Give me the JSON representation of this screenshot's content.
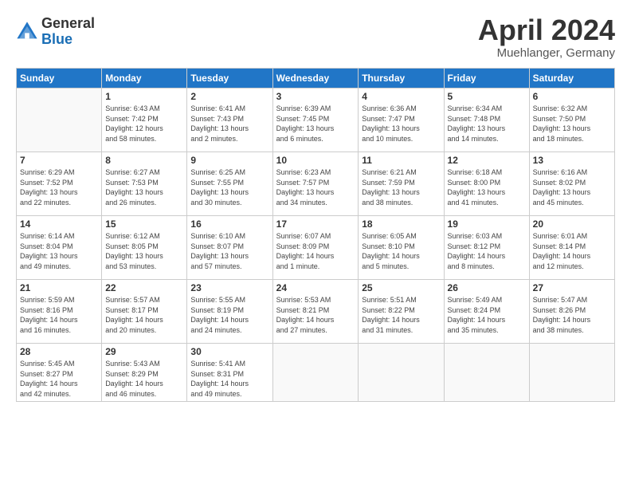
{
  "header": {
    "logo": {
      "general": "General",
      "blue": "Blue"
    },
    "title": "April 2024",
    "location": "Muehlanger, Germany"
  },
  "calendar": {
    "days_of_week": [
      "Sunday",
      "Monday",
      "Tuesday",
      "Wednesday",
      "Thursday",
      "Friday",
      "Saturday"
    ],
    "weeks": [
      [
        {
          "day": "",
          "info": ""
        },
        {
          "day": "1",
          "info": "Sunrise: 6:43 AM\nSunset: 7:42 PM\nDaylight: 12 hours\nand 58 minutes."
        },
        {
          "day": "2",
          "info": "Sunrise: 6:41 AM\nSunset: 7:43 PM\nDaylight: 13 hours\nand 2 minutes."
        },
        {
          "day": "3",
          "info": "Sunrise: 6:39 AM\nSunset: 7:45 PM\nDaylight: 13 hours\nand 6 minutes."
        },
        {
          "day": "4",
          "info": "Sunrise: 6:36 AM\nSunset: 7:47 PM\nDaylight: 13 hours\nand 10 minutes."
        },
        {
          "day": "5",
          "info": "Sunrise: 6:34 AM\nSunset: 7:48 PM\nDaylight: 13 hours\nand 14 minutes."
        },
        {
          "day": "6",
          "info": "Sunrise: 6:32 AM\nSunset: 7:50 PM\nDaylight: 13 hours\nand 18 minutes."
        }
      ],
      [
        {
          "day": "7",
          "info": "Sunrise: 6:29 AM\nSunset: 7:52 PM\nDaylight: 13 hours\nand 22 minutes."
        },
        {
          "day": "8",
          "info": "Sunrise: 6:27 AM\nSunset: 7:53 PM\nDaylight: 13 hours\nand 26 minutes."
        },
        {
          "day": "9",
          "info": "Sunrise: 6:25 AM\nSunset: 7:55 PM\nDaylight: 13 hours\nand 30 minutes."
        },
        {
          "day": "10",
          "info": "Sunrise: 6:23 AM\nSunset: 7:57 PM\nDaylight: 13 hours\nand 34 minutes."
        },
        {
          "day": "11",
          "info": "Sunrise: 6:21 AM\nSunset: 7:59 PM\nDaylight: 13 hours\nand 38 minutes."
        },
        {
          "day": "12",
          "info": "Sunrise: 6:18 AM\nSunset: 8:00 PM\nDaylight: 13 hours\nand 41 minutes."
        },
        {
          "day": "13",
          "info": "Sunrise: 6:16 AM\nSunset: 8:02 PM\nDaylight: 13 hours\nand 45 minutes."
        }
      ],
      [
        {
          "day": "14",
          "info": "Sunrise: 6:14 AM\nSunset: 8:04 PM\nDaylight: 13 hours\nand 49 minutes."
        },
        {
          "day": "15",
          "info": "Sunrise: 6:12 AM\nSunset: 8:05 PM\nDaylight: 13 hours\nand 53 minutes."
        },
        {
          "day": "16",
          "info": "Sunrise: 6:10 AM\nSunset: 8:07 PM\nDaylight: 13 hours\nand 57 minutes."
        },
        {
          "day": "17",
          "info": "Sunrise: 6:07 AM\nSunset: 8:09 PM\nDaylight: 14 hours\nand 1 minute."
        },
        {
          "day": "18",
          "info": "Sunrise: 6:05 AM\nSunset: 8:10 PM\nDaylight: 14 hours\nand 5 minutes."
        },
        {
          "day": "19",
          "info": "Sunrise: 6:03 AM\nSunset: 8:12 PM\nDaylight: 14 hours\nand 8 minutes."
        },
        {
          "day": "20",
          "info": "Sunrise: 6:01 AM\nSunset: 8:14 PM\nDaylight: 14 hours\nand 12 minutes."
        }
      ],
      [
        {
          "day": "21",
          "info": "Sunrise: 5:59 AM\nSunset: 8:16 PM\nDaylight: 14 hours\nand 16 minutes."
        },
        {
          "day": "22",
          "info": "Sunrise: 5:57 AM\nSunset: 8:17 PM\nDaylight: 14 hours\nand 20 minutes."
        },
        {
          "day": "23",
          "info": "Sunrise: 5:55 AM\nSunset: 8:19 PM\nDaylight: 14 hours\nand 24 minutes."
        },
        {
          "day": "24",
          "info": "Sunrise: 5:53 AM\nSunset: 8:21 PM\nDaylight: 14 hours\nand 27 minutes."
        },
        {
          "day": "25",
          "info": "Sunrise: 5:51 AM\nSunset: 8:22 PM\nDaylight: 14 hours\nand 31 minutes."
        },
        {
          "day": "26",
          "info": "Sunrise: 5:49 AM\nSunset: 8:24 PM\nDaylight: 14 hours\nand 35 minutes."
        },
        {
          "day": "27",
          "info": "Sunrise: 5:47 AM\nSunset: 8:26 PM\nDaylight: 14 hours\nand 38 minutes."
        }
      ],
      [
        {
          "day": "28",
          "info": "Sunrise: 5:45 AM\nSunset: 8:27 PM\nDaylight: 14 hours\nand 42 minutes."
        },
        {
          "day": "29",
          "info": "Sunrise: 5:43 AM\nSunset: 8:29 PM\nDaylight: 14 hours\nand 46 minutes."
        },
        {
          "day": "30",
          "info": "Sunrise: 5:41 AM\nSunset: 8:31 PM\nDaylight: 14 hours\nand 49 minutes."
        },
        {
          "day": "",
          "info": ""
        },
        {
          "day": "",
          "info": ""
        },
        {
          "day": "",
          "info": ""
        },
        {
          "day": "",
          "info": ""
        }
      ]
    ]
  }
}
